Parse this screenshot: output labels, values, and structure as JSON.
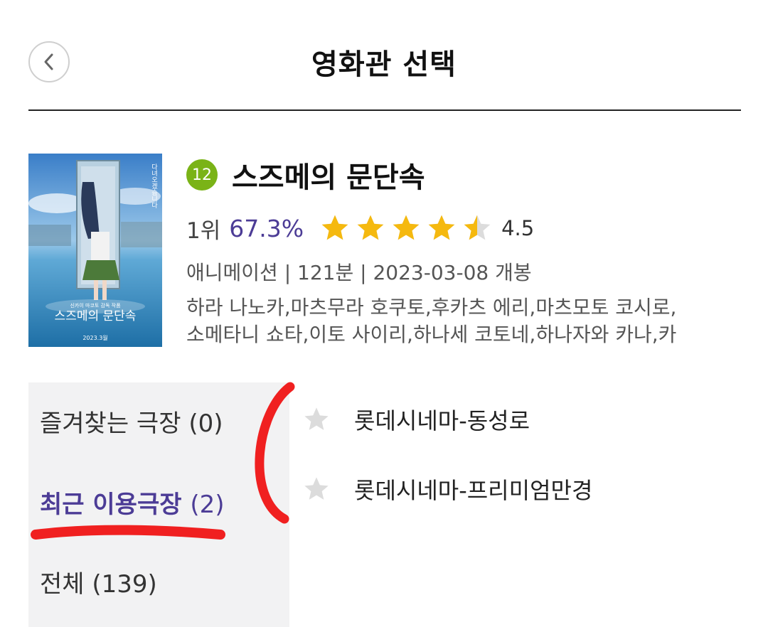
{
  "header": {
    "title": "영화관 선택",
    "back_icon": "chevron-left-icon"
  },
  "movie": {
    "age_rating": "12",
    "age_rating_color": "#7ab317",
    "title": "스즈메의 문단속",
    "rank": "1위",
    "reservation_rate": "67.3%",
    "reservation_rate_color": "#4c3c96",
    "star_rating": 4.5,
    "star_max": 5,
    "score": "4.5",
    "meta": "애니메이션 | 121분 | 2023-03-08 개봉",
    "cast_lines": [
      "하라 나노카,마츠무라 호쿠토,후카츠 에리,마츠모토 코시로,",
      "소메타니 쇼타,이토 사이리,하나세 코토네,하나자와 카나,카"
    ],
    "poster": {
      "title": "스즈메의 문단속",
      "subtitle": "신카이 마코토 감독 작품",
      "vertical_tagline": "다녀오겠습니다",
      "date": "2023.3월"
    }
  },
  "tabs": [
    {
      "label": "즐겨찾는 극장",
      "count": "(0)",
      "active": false
    },
    {
      "label": "최근 이용극장",
      "count": "(2)",
      "active": true
    },
    {
      "label": "전체",
      "count": "(139)",
      "active": false
    }
  ],
  "theaters": [
    {
      "name": "롯데시네마-동성로",
      "favorite": false
    },
    {
      "name": "롯데시네마-프리미엄만경",
      "favorite": false
    }
  ],
  "colors": {
    "accent": "#4c3c96",
    "star_gold": "#f5b90f",
    "star_empty": "#dcdcdc",
    "annotation_red": "#f02020",
    "side_panel_bg": "#f2f2f3"
  }
}
